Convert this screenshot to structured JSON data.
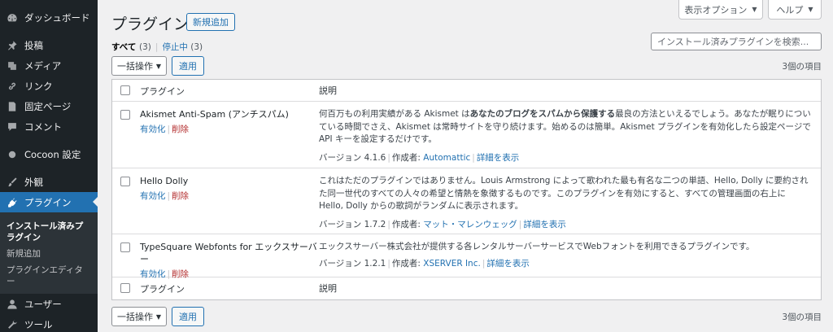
{
  "sidebar": {
    "items": [
      {
        "label": "ダッシュボード",
        "icon": "dashboard-icon"
      },
      {
        "label": "投稿",
        "icon": "pin-icon"
      },
      {
        "label": "メディア",
        "icon": "media-icon"
      },
      {
        "label": "リンク",
        "icon": "link-icon"
      },
      {
        "label": "固定ページ",
        "icon": "page-icon"
      },
      {
        "label": "コメント",
        "icon": "comment-icon"
      },
      {
        "label": "Cocoon 設定",
        "icon": "circle-icon"
      },
      {
        "label": "外観",
        "icon": "brush-icon"
      },
      {
        "label": "プラグイン",
        "icon": "plugin-icon"
      },
      {
        "label": "ユーザー",
        "icon": "user-icon"
      },
      {
        "label": "ツール",
        "icon": "wrench-icon"
      }
    ],
    "submenu": [
      "インストール済みプラグイン",
      "新規追加",
      "プラグインエディター"
    ]
  },
  "screen_options": "表示オプション",
  "help": "ヘルプ",
  "page_title": "プラグイン",
  "add_new": "新規追加",
  "filters": {
    "all": "すべて",
    "all_count": "(3)",
    "inactive": "停止中",
    "inactive_count": "(3)"
  },
  "search": {
    "placeholder": "インストール済みプラグインを検索..."
  },
  "bulk": {
    "select": "一括操作",
    "apply": "適用"
  },
  "items_count": "3個の項目",
  "table": {
    "col_plugin": "プラグイン",
    "col_desc": "説明",
    "plugins": [
      {
        "name": "Akismet Anti-Spam (アンチスパム)",
        "activate": "有効化",
        "delete": "削除",
        "desc_pre": "何百万もの利用実績がある Akismet は",
        "desc_bold": "あなたのブログをスパムから保護する",
        "desc_post": "最良の方法といえるでしょう。あなたが眠りについている時間でさえ、Akismet は常時サイトを守り続けます。始めるのは簡単。Akismet プラグインを有効化したら設定ページで API キーを設定するだけです。",
        "version": "バージョン 4.1.6",
        "author_label": "作成者:",
        "author": "Automattic",
        "details": "詳細を表示"
      },
      {
        "name": "Hello Dolly",
        "activate": "有効化",
        "delete": "削除",
        "desc_pre": "これはただのプラグインではありません。Louis Armstrong によって歌われた最も有名な二つの単語、Hello, Dolly に要約された同一世代のすべての人々の希望と情熱を象徴するものです。このプラグインを有効にすると、すべての管理画面の右上に Hello, Dolly からの歌詞がランダムに表示されます。",
        "desc_bold": "",
        "desc_post": "",
        "version": "バージョン 1.7.2",
        "author_label": "作成者:",
        "author": "マット・マレンウェッグ",
        "details": "詳細を表示"
      },
      {
        "name": "TypeSquare Webfonts for エックスサーバー",
        "activate": "有効化",
        "delete": "削除",
        "desc_pre": "エックスサーバー株式会社が提供する各レンタルサーバーサービスでWebフォントを利用できるプラグインです。",
        "desc_bold": "",
        "desc_post": "",
        "version": "バージョン 1.2.1",
        "author_label": "作成者:",
        "author": "XSERVER Inc.",
        "details": "詳細を表示"
      }
    ]
  },
  "colors": {
    "accent": "#2271b1",
    "sidebar": "#1d2327",
    "delete": "#b32d2e"
  }
}
